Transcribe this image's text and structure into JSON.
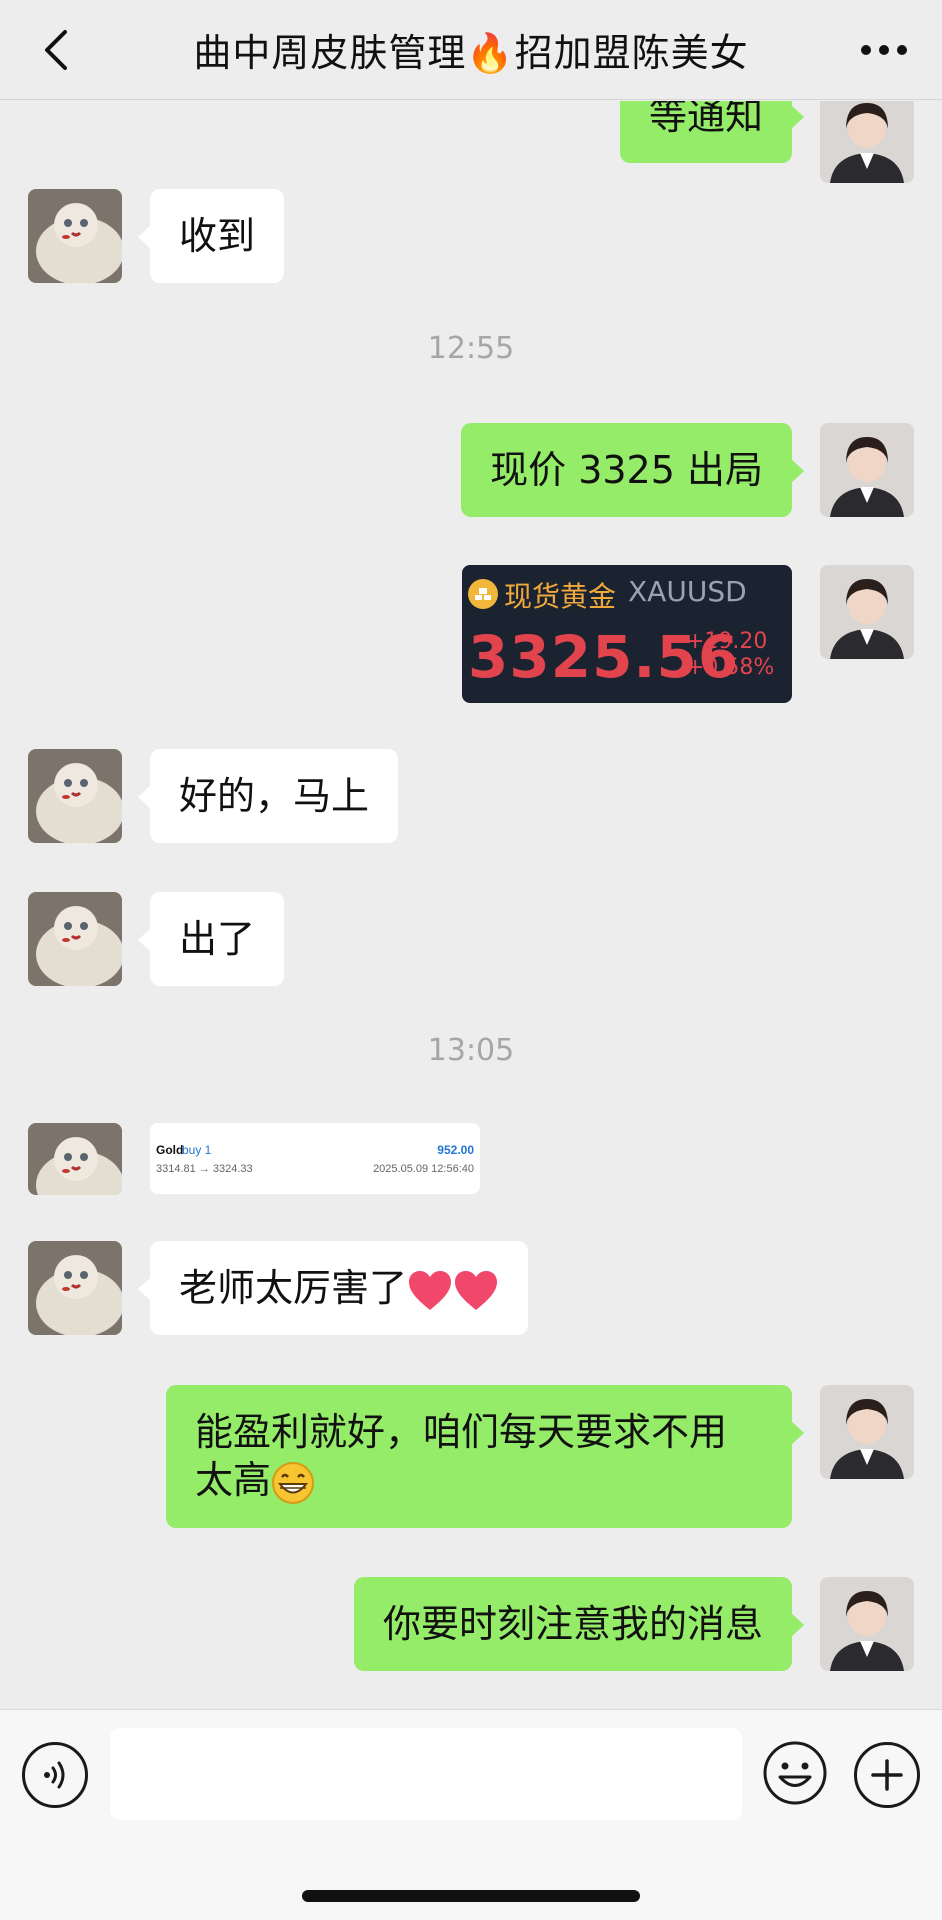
{
  "header": {
    "title": "曲中周皮肤管理🔥招加盟陈美女",
    "back_icon": "chevron-left-icon",
    "more_icon": "more-dots-icon"
  },
  "messages": {
    "partial_top": "等通知",
    "m1": "收到",
    "time1": "12:55",
    "m2": "现价 3325 出局",
    "gold_card": {
      "name": "现货黄金",
      "symbol": "XAUUSD",
      "price": "3325.56",
      "change": "+19.20",
      "change_pct": "+0.58%"
    },
    "m3": "好的，马上",
    "m4": "出了",
    "time2": "13:05",
    "trade_card": {
      "symbol": "Gold",
      "direction": "buy 1",
      "profit": "952.00",
      "prices": "3314.81 → 3324.33",
      "timestamp": "2025.05.09 12:56:40"
    },
    "m5": "老师太厉害了",
    "m6_line1": "能盈利就好，咱们每天要求不用",
    "m6_line2": "太高",
    "m7": "你要时刻注意我的消息"
  },
  "input": {
    "placeholder": "",
    "voice_icon": "voice-icon",
    "emoji_icon": "smiley-icon",
    "plus_icon": "plus-icon"
  },
  "colors": {
    "out_bubble": "#95ec69",
    "in_bubble": "#ffffff",
    "background": "#ededed",
    "gold_red": "#e2444e"
  }
}
